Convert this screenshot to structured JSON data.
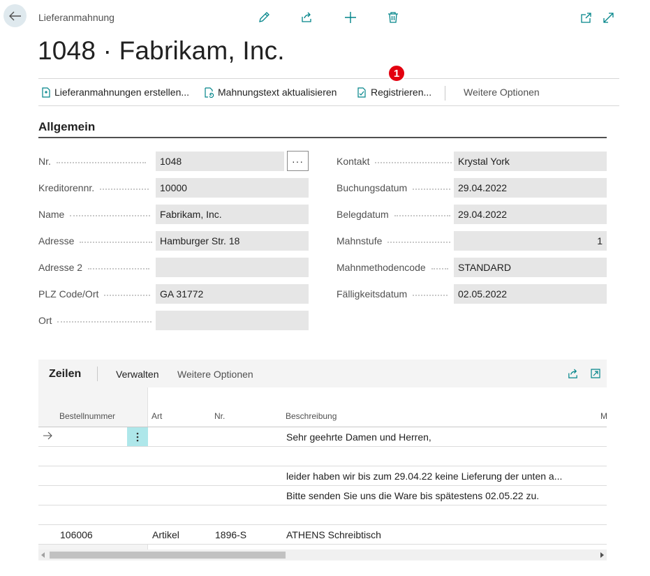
{
  "header": {
    "breadcrumb": "Lieferanmahnung",
    "title": "1048 · Fabrikam, Inc."
  },
  "actions": {
    "create": "Lieferanmahnungen erstellen...",
    "update_text": "Mahnungstext aktualisieren",
    "register": "Registrieren...",
    "more": "Weitere Optionen",
    "badge": "1"
  },
  "general": {
    "section_title": "Allgemein",
    "left": [
      {
        "label": "Nr.",
        "value": "1048"
      },
      {
        "label": "Kreditorennr.",
        "value": "10000"
      },
      {
        "label": "Name",
        "value": "Fabrikam, Inc."
      },
      {
        "label": "Adresse",
        "value": "Hamburger Str. 18"
      },
      {
        "label": "Adresse 2",
        "value": ""
      },
      {
        "label": "PLZ Code/Ort",
        "value": "GA 31772"
      },
      {
        "label": "Ort",
        "value": ""
      }
    ],
    "right": [
      {
        "label": "Kontakt",
        "value": "Krystal York"
      },
      {
        "label": "Buchungsdatum",
        "value": "29.04.2022"
      },
      {
        "label": "Belegdatum",
        "value": "29.04.2022"
      },
      {
        "label": "Mahnstufe",
        "value": "1"
      },
      {
        "label": "Mahnmethodencode",
        "value": "STANDARD"
      },
      {
        "label": "Fälligkeitsdatum",
        "value": "02.05.2022"
      }
    ],
    "ellipsis": "···"
  },
  "lines": {
    "title": "Zeilen",
    "manage": "Verwalten",
    "more": "Weitere Optionen",
    "columns": [
      "Bestellnummer",
      "Art",
      "Nr.",
      "Beschreibung",
      "M"
    ],
    "rows": [
      {
        "bestellnummer": "",
        "art": "",
        "nr": "",
        "beschreibung": "Sehr geehrte Damen und Herren,"
      },
      {
        "bestellnummer": "",
        "art": "",
        "nr": "",
        "beschreibung": ""
      },
      {
        "bestellnummer": "",
        "art": "",
        "nr": "",
        "beschreibung": "leider haben wir bis zum 29.04.22 keine Lieferung der unten a..."
      },
      {
        "bestellnummer": "",
        "art": "",
        "nr": "",
        "beschreibung": "Bitte senden Sie uns die Ware bis spätestens 02.05.22 zu."
      },
      {
        "bestellnummer": "",
        "art": "",
        "nr": "",
        "beschreibung": ""
      },
      {
        "bestellnummer": "106006",
        "art": "Artikel",
        "nr": "1896-S",
        "beschreibung": "ATHENS Schreibtisch"
      }
    ]
  },
  "colors": {
    "accent": "#008489",
    "badge": "#e3000f",
    "field_bg": "#e6e6e6"
  }
}
